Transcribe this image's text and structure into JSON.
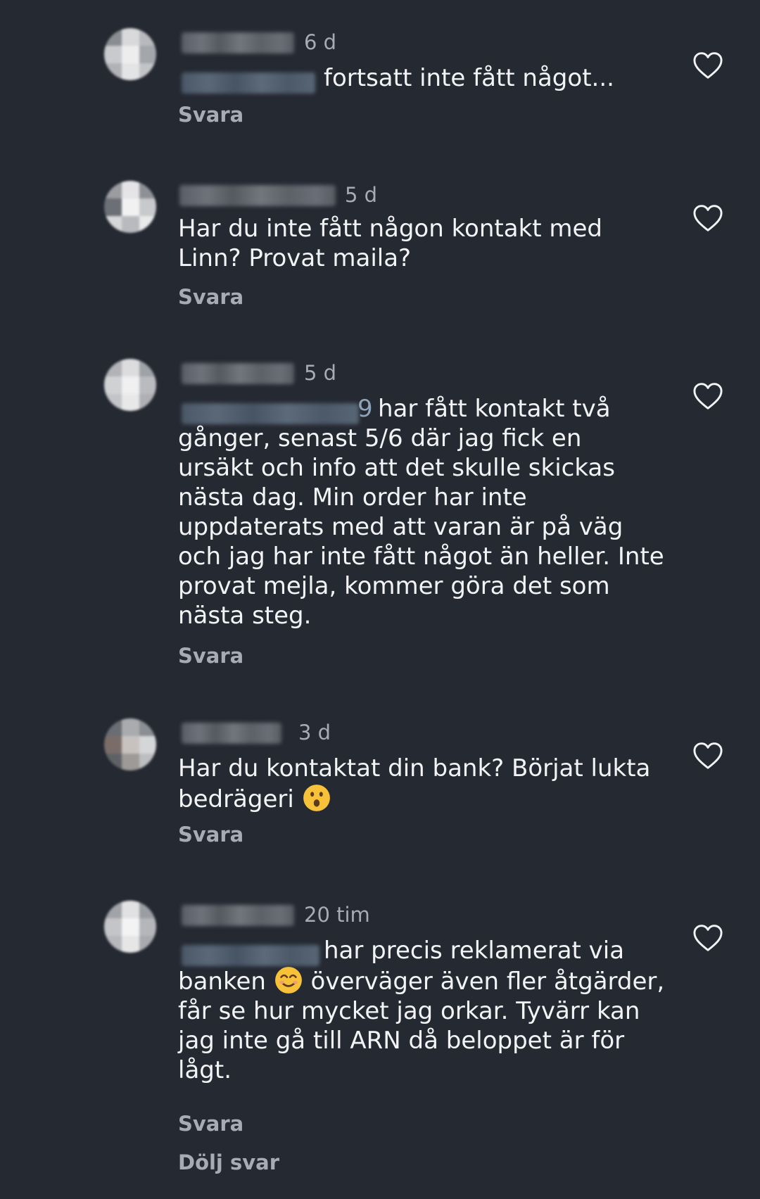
{
  "colors": {
    "background": "#252932",
    "text_primary": "#f2f3f5",
    "text_secondary": "#a7abb3"
  },
  "comments": [
    {
      "time": "6 d",
      "text": "fortsatt inte fått något...",
      "reply_label": "Svara"
    },
    {
      "time": "5 d",
      "text": "Har du inte fått någon kontakt med\nLinn? Provat maila?",
      "reply_label": "Svara"
    },
    {
      "time": "5 d",
      "text_partial_mention_char": "9",
      "text": "har fått kontakt två\ngånger, senast 5/6 där jag fick en\nursäkt och info att det skulle skickas\nnästa dag. Min order har inte\nuppdaterats med att varan är på väg\noch jag har inte fått något än heller. Inte\nprovat mejla, kommer göra det som\nnästa steg.",
      "reply_label": "Svara"
    },
    {
      "time": "3 d",
      "text_before_emoji": "Har du kontaktat din bank? Börjat lukta\nbedrägeri",
      "emoji": "astonished-face-emoji",
      "reply_label": "Svara"
    },
    {
      "time": "20 tim",
      "text_line1": "har precis reklamerat via",
      "text_before_emoji": "banken",
      "emoji": "smiling-face-emoji",
      "text_after_emoji": "överväger även fler åtgärder,\nfår se hur mycket jag orkar. Tyvärr kan\njag inte gå till ARN då beloppet är för\nlågt.",
      "reply_label": "Svara"
    }
  ],
  "hide_replies_label": "Dölj svar",
  "icons": {
    "like": "heart-outline-icon"
  }
}
